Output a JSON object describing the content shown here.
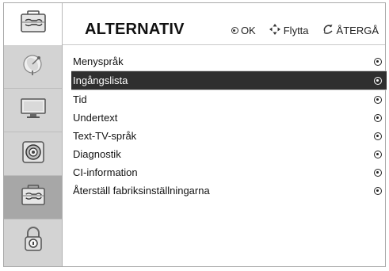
{
  "header": {
    "title": "ALTERNATIV",
    "hint_ok": "OK",
    "hint_move": "Flytta",
    "hint_back": "ÅTERGÅ"
  },
  "sidebar": {
    "items": [
      {
        "icon": "satellite-dish-icon"
      },
      {
        "icon": "tv-monitor-icon"
      },
      {
        "icon": "speaker-icon"
      },
      {
        "icon": "toolbox-icon",
        "active": true
      },
      {
        "icon": "padlock-icon"
      }
    ]
  },
  "menu": {
    "items": [
      {
        "label": "Menyspråk"
      },
      {
        "label": "Ingångslista",
        "selected": true
      },
      {
        "label": "Tid"
      },
      {
        "label": "Undertext"
      },
      {
        "label": "Text-TV-språk"
      },
      {
        "label": "Diagnostik"
      },
      {
        "label": "CI-information"
      },
      {
        "label": "Återställ fabriksinställningarna"
      }
    ]
  },
  "colors": {
    "selected_row": "#2f2f2f",
    "sidebar_bg": "#d3d3d3",
    "sidebar_active": "#a7a7a7"
  }
}
